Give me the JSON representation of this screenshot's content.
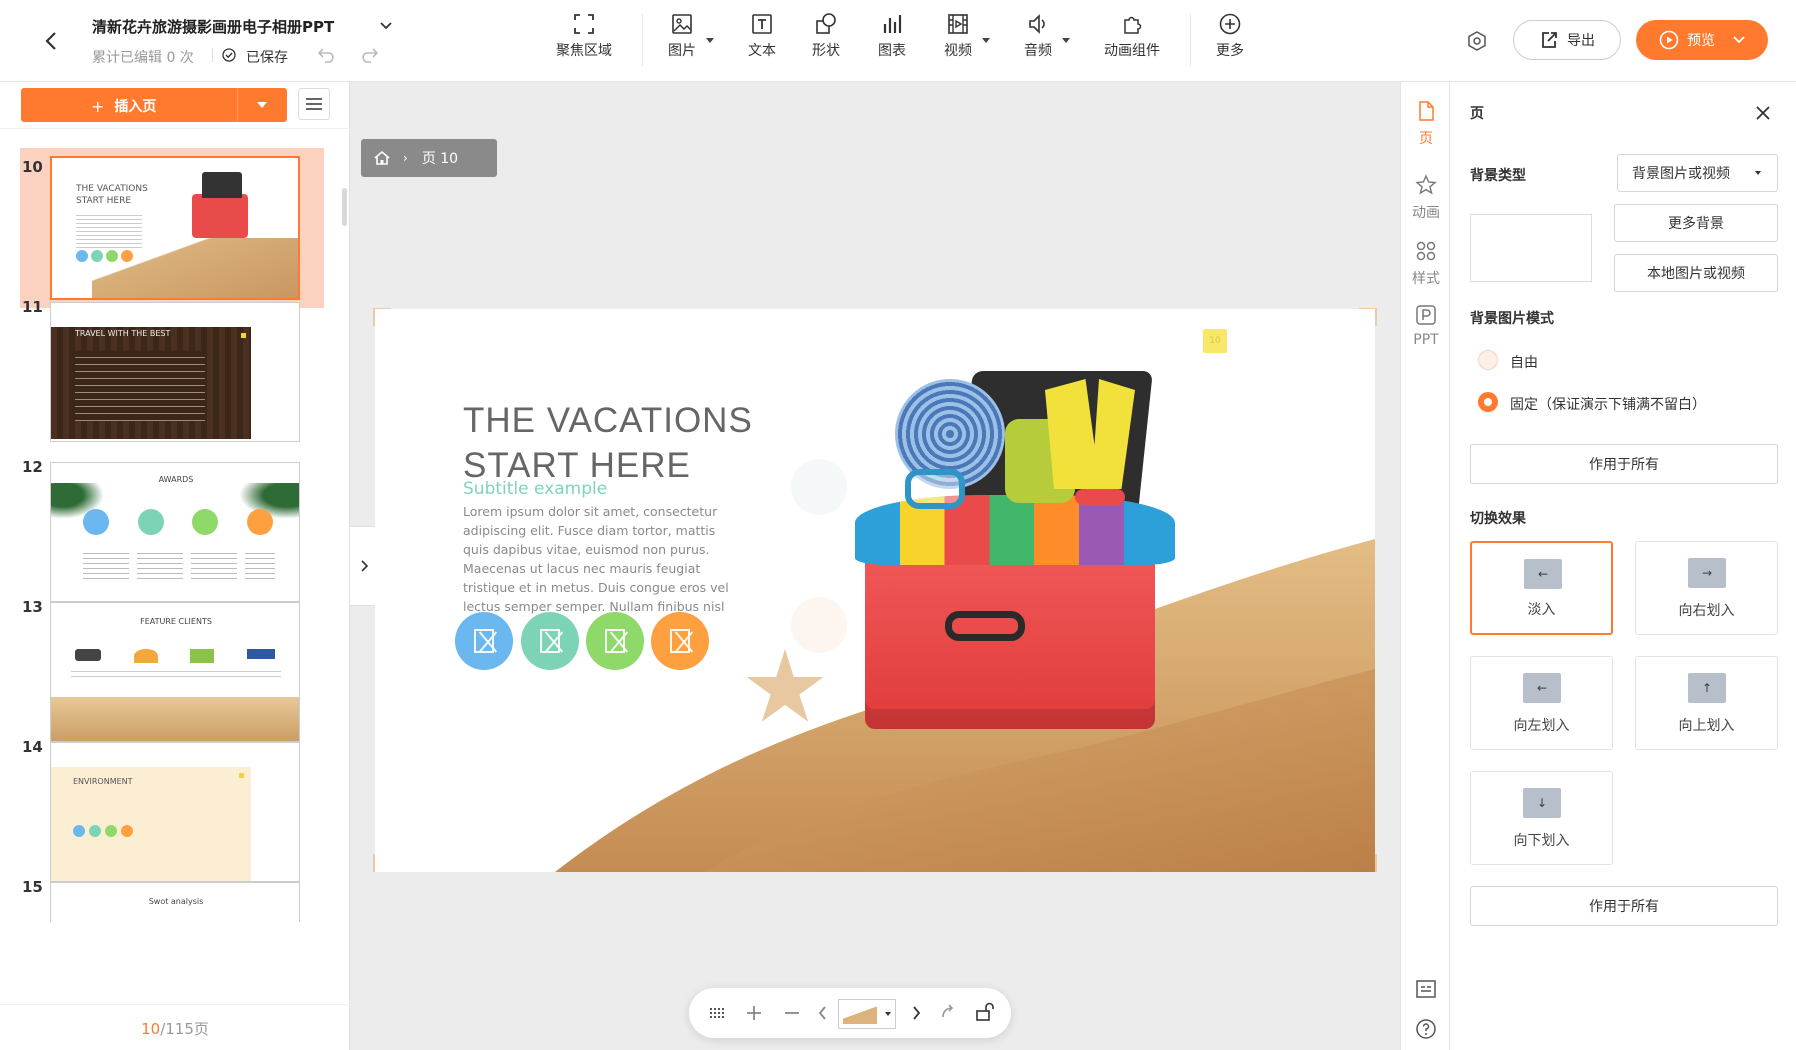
{
  "app": {
    "doc_title": "清新花卉旅游摄影画册电子相册PPT",
    "edit_count": "累计已编辑 0 次",
    "saved": "已保存",
    "export_label": "导出",
    "preview_label": "预览"
  },
  "toolbar": {
    "focus": "聚焦区域",
    "image": "图片",
    "text": "文本",
    "shape": "形状",
    "chart": "图表",
    "video": "视频",
    "audio": "音频",
    "anim_component": "动画组件",
    "more": "更多"
  },
  "left": {
    "insert_page": "插入页",
    "pager_current": "10",
    "pager_total": "/115页",
    "slides": [
      {
        "num": "10",
        "caption1": "THE VACATIONS",
        "caption2": "START HERE"
      },
      {
        "num": "11",
        "caption1": "TRAVEL WITH THE BEST"
      },
      {
        "num": "12",
        "caption1": "AWARDS"
      },
      {
        "num": "13",
        "caption1": "FEATURE CLIENTS"
      },
      {
        "num": "14",
        "caption1": "ENVIRONMENT"
      },
      {
        "num": "15",
        "caption1": "Swot analysis"
      }
    ]
  },
  "breadcrumb": {
    "page": "页 10"
  },
  "slide": {
    "title1": "THE VACATIONS",
    "title2": "START HERE",
    "subtitle": "Subtitle example",
    "body": "Lorem ipsum dolor sit amet, consectetur adipiscing elit. Fusce diam tortor, mattis quis dapibus vitae, euismod non purus. Maecenas ut lacus nec mauris feugiat tristique et in metus. Duis congue eros vel lectus semper semper. Nullam finibus nisl ut ligula vestibulum, ut semper ex",
    "page_tag": "10",
    "circle_colors": [
      "#6bb8f0",
      "#7dd3b5",
      "#8fd86a",
      "#ffa040"
    ]
  },
  "rail": {
    "page": "页",
    "animation": "动画",
    "style": "样式",
    "ppt": "PPT"
  },
  "panel": {
    "title": "页",
    "bg_type_label": "背景类型",
    "bg_type_value": "背景图片或视频",
    "more_bg": "更多背景",
    "local_media": "本地图片或视频",
    "bg_mode_label": "背景图片模式",
    "mode_free": "自由",
    "mode_fixed": "固定（保证演示下铺满不留白）",
    "apply_all": "作用于所有",
    "transition_label": "切换效果",
    "effects": [
      "淡入",
      "向右划入",
      "向左划入",
      "向上划入",
      "向下划入"
    ],
    "apply_all_2": "作用于所有"
  },
  "colors": {
    "accent": "#ff7a2f",
    "selected_thumb_bg": "#fbd2c0"
  }
}
